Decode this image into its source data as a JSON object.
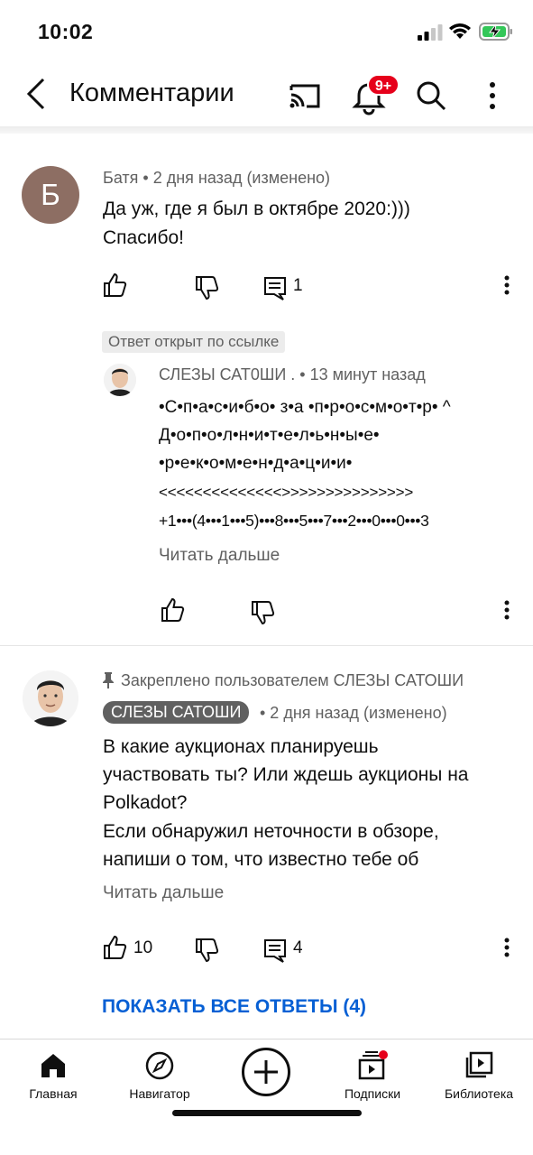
{
  "status_bar": {
    "time": "10:02"
  },
  "app_bar": {
    "title": "Комментарии",
    "notification_badge": "9+"
  },
  "comments": [
    {
      "avatar_letter": "Б",
      "meta": "Батя • 2 дня назад (изменено)",
      "text_lines": [
        "Да уж, где я был в октябре 2020:)))",
        "Спасибо!"
      ],
      "reply_count": "1"
    }
  ],
  "linked_reply": {
    "chip": "Ответ открыт по ссылке",
    "meta": "СЛЕЗЫ САТ0ШИ . • 13 минут назад",
    "lines": [
      "•С•п•а•с•и•б•о• з•а •п•р•о•с•м•о•т•р• ^",
      "Д•о•п•о•л•н•и•т•е•л•ь•н•ы•е•",
      "•р•е•к•о•м•е•н•д•а•ц•и•и•",
      "<<<<<<<<<<<<<<>>>>>>>>>>>>>>>",
      "+1•••(4•••1•••5)•••8•••5•••7•••2•••0•••0•••3"
    ],
    "read_more": "Читать дальше"
  },
  "pinned_comment": {
    "pinned_label": "Закреплено пользователем СЛЕЗЫ САТОШИ",
    "author": "СЛЕЗЫ САТОШИ",
    "time": "• 2 дня назад (изменено)",
    "text_lines": [
      "В какие аукционах планируешь",
      "участвовать ты? Или ждешь аукционы на",
      "Polkadot?",
      "Если обнаружил неточности в обзоре,",
      "напиши о том, что известно тебе об"
    ],
    "read_more": "Читать дальше",
    "like_count": "10",
    "reply_count": "4",
    "show_all": "ПОКАЗАТЬ ВСЕ ОТВЕТЫ (4)"
  },
  "bottom_nav": {
    "home": "Главная",
    "explore": "Навигатор",
    "subscriptions": "Подписки",
    "library": "Библиотека"
  },
  "colors": {
    "accent_link": "#065fd4",
    "badge_red": "#e6001b",
    "avatar_brown": "#8d6e63"
  }
}
